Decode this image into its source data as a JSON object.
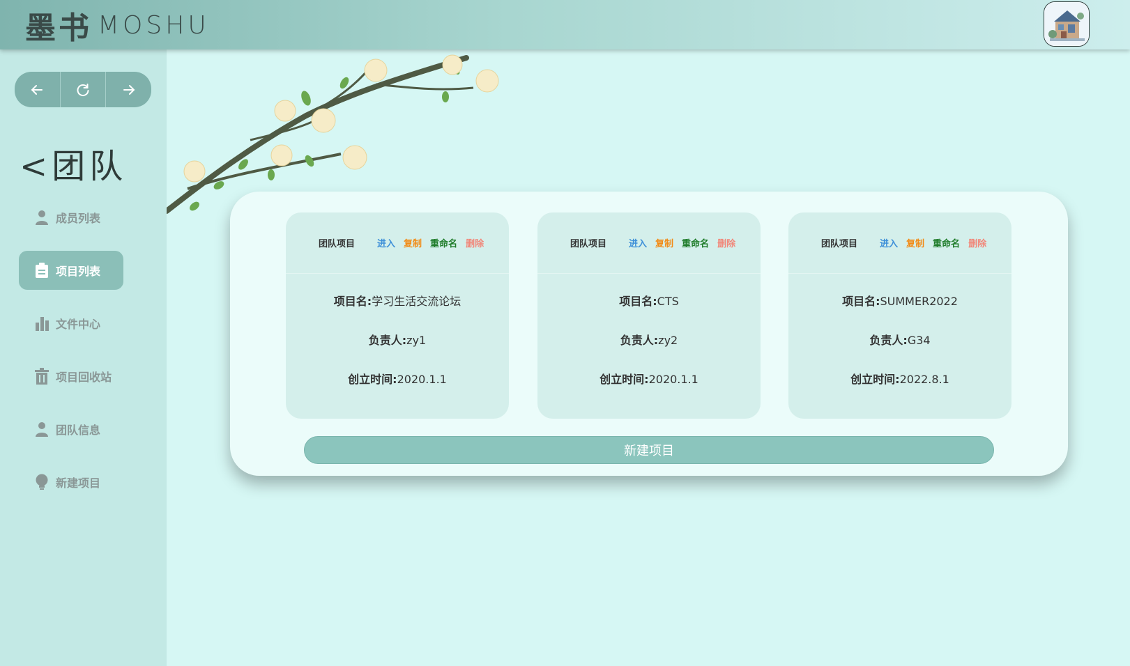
{
  "header": {
    "logo_cn": "墨书",
    "logo_en": "MOSHU"
  },
  "nav": {
    "back_icon": "arrow-left-icon",
    "refresh_icon": "refresh-icon",
    "forward_icon": "arrow-right-icon"
  },
  "sidebar": {
    "title": "<团队",
    "items": [
      {
        "label": "成员列表",
        "icon": "person-icon",
        "active": false
      },
      {
        "label": "项目列表",
        "icon": "clipboard-icon",
        "active": true
      },
      {
        "label": "文件中心",
        "icon": "bar-chart-icon",
        "active": false
      },
      {
        "label": "项目回收站",
        "icon": "trash-icon",
        "active": false
      },
      {
        "label": "团队信息",
        "icon": "person-icon",
        "active": false
      },
      {
        "label": "新建项目",
        "icon": "bulb-icon",
        "active": false
      }
    ]
  },
  "actions": {
    "enter": "进入",
    "copy": "复制",
    "rename": "重命名",
    "delete": "删除"
  },
  "projects": [
    {
      "type": "团队项目",
      "name_label": "项目名:",
      "name": "学习生活交流论坛",
      "owner_label": "负责人:",
      "owner": "zy1",
      "created_label": "创立时间:",
      "created": "2020.1.1"
    },
    {
      "type": "团队项目",
      "name_label": "项目名:",
      "name": "CTS",
      "owner_label": "负责人:",
      "owner": "zy2",
      "created_label": "创立时间:",
      "created": "2020.1.1"
    },
    {
      "type": "团队项目",
      "name_label": "项目名:",
      "name": "SUMMER2022",
      "owner_label": "负责人:",
      "owner": "G34",
      "created_label": "创立时间:",
      "created": "2022.8.1"
    }
  ],
  "new_project_button": "新建项目",
  "colors": {
    "accent": "#8bc5bd",
    "background": "#d6f7f4",
    "sidebar": "#c3e9e5",
    "enter": "#3d8fd8",
    "copy": "#f28b16",
    "rename": "#1f7c2a",
    "delete": "#f1887a"
  }
}
